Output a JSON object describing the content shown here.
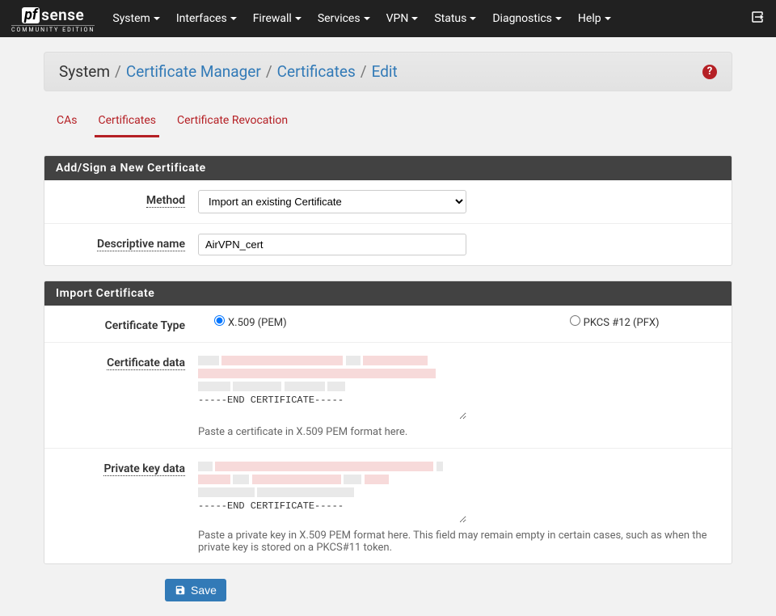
{
  "nav": {
    "items": [
      "System",
      "Interfaces",
      "Firewall",
      "Services",
      "VPN",
      "Status",
      "Diagnostics",
      "Help"
    ]
  },
  "brand": {
    "pf": "pf",
    "sense": "sense",
    "sub": "COMMUNITY EDITION"
  },
  "breadcrumb": {
    "root": "System",
    "a": "Certificate Manager",
    "b": "Certificates",
    "c": "Edit"
  },
  "tabs": {
    "cas": "CAs",
    "certs": "Certificates",
    "crl": "Certificate Revocation"
  },
  "panel1": {
    "title": "Add/Sign a New Certificate",
    "method_label": "Method",
    "method_value": "Import an existing Certificate",
    "descr_label": "Descriptive name",
    "descr_value": "AirVPN_cert"
  },
  "panel2": {
    "title": "Import Certificate",
    "certtype_label": "Certificate Type",
    "certtype_pem": "X.509 (PEM)",
    "certtype_pfx": "PKCS #12 (PFX)",
    "certdata_label": "Certificate data",
    "certdata_help": "Paste a certificate in X.509 PEM format here.",
    "pkey_label": "Private key data",
    "pkey_help": "Paste a private key in X.509 PEM format here. This field may remain empty in certain cases, such as when the private key is stored on a PKCS#11 token.",
    "end_cert": "-----END CERTIFICATE-----"
  },
  "save_label": "Save"
}
